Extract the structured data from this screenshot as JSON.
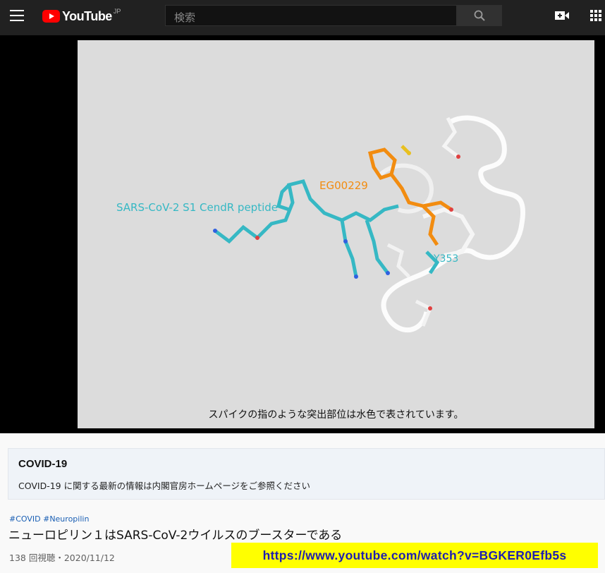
{
  "header": {
    "logo_text": "YouTube",
    "logo_region": "JP",
    "search_placeholder": "検索",
    "icons": [
      "menu-icon",
      "youtube-logo-icon",
      "search-icon",
      "create-video-icon",
      "apps-grid-icon"
    ]
  },
  "video": {
    "caption": "スパイクの指のような突出部位は水色で表されています。",
    "labels": {
      "peptide": "SARS-CoV-2 S1 CendR peptide",
      "compound": "EG00229",
      "residue": "Y353"
    },
    "colors": {
      "peptide": "#36b8c4",
      "compound": "#f28c10",
      "protein": "#f4f4f4"
    }
  },
  "covid_panel": {
    "title": "COVID-19",
    "text": "COVID-19 に関する最新の情報は内閣官房ホームページをご参照ください"
  },
  "video_info": {
    "tags": "#COVID #Neuropilin",
    "title": "ニューロピリン１はSARS-CoV-2ウイルスのブースターである",
    "meta": "138 回視聴・2020/11/12"
  },
  "url_banner": "https://www.youtube.com/watch?v=BGKER0Efb5s"
}
